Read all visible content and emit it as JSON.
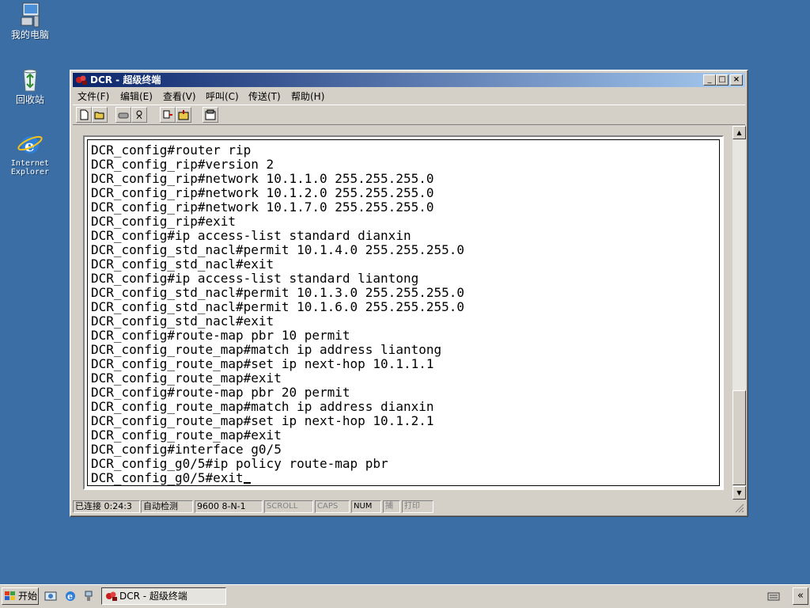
{
  "desktop": {
    "icons": [
      {
        "label": "我的电脑",
        "icon": "my-computer-icon"
      },
      {
        "label": "回收站",
        "icon": "recycle-bin-icon"
      },
      {
        "label": "Internet Explorer",
        "line1": "Internet",
        "line2": "Explorer",
        "icon": "internet-explorer-icon"
      }
    ],
    "background_color": "#3a6ea5"
  },
  "window": {
    "title": "DCR - 超级终端",
    "title_gradient": [
      "#0a246a",
      "#a6caf0"
    ],
    "controls": {
      "minimize": "_",
      "maximize": "□",
      "close": "×"
    },
    "menu": [
      {
        "label": "文件(F)"
      },
      {
        "label": "编辑(E)"
      },
      {
        "label": "查看(V)"
      },
      {
        "label": "呼叫(C)"
      },
      {
        "label": "传送(T)"
      },
      {
        "label": "帮助(H)"
      }
    ],
    "toolbar": [
      "new-icon",
      "open-icon",
      "connect-icon",
      "disconnect-icon",
      "send-icon",
      "receive-icon",
      "properties-icon"
    ]
  },
  "terminal": {
    "lines": [
      "DCR_config#router rip",
      "DCR_config_rip#version 2",
      "DCR_config_rip#network 10.1.1.0 255.255.255.0",
      "DCR_config_rip#network 10.1.2.0 255.255.255.0",
      "DCR_config_rip#network 10.1.7.0 255.255.255.0",
      "DCR_config_rip#exit",
      "DCR_config#ip access-list standard dianxin",
      "DCR_config_std_nacl#permit 10.1.4.0 255.255.255.0",
      "DCR_config_std_nacl#exit",
      "DCR_config#ip access-list standard liantong",
      "DCR_config_std_nacl#permit 10.1.3.0 255.255.255.0",
      "DCR_config_std_nacl#permit 10.1.6.0 255.255.255.0",
      "DCR_config_std_nacl#exit",
      "DCR_config#route-map pbr 10 permit",
      "DCR_config_route_map#match ip address liantong",
      "DCR_config_route_map#set ip next-hop 10.1.1.1",
      "DCR_config_route_map#exit",
      "DCR_config#route-map pbr 20 permit",
      "DCR_config_route_map#match ip address dianxin",
      "DCR_config_route_map#set ip next-hop 10.1.2.1",
      "DCR_config_route_map#exit",
      "DCR_config#interface g0/5",
      "DCR_config_g0/5#ip policy route-map pbr",
      "DCR_config_g0/5#exit"
    ]
  },
  "statusbar": {
    "connected": "已连接 0:24:3",
    "detect": "自动检测",
    "port": "9600 8-N-1",
    "scroll": "SCROLL",
    "caps": "CAPS",
    "num": "NUM",
    "capture": "捕",
    "print": "打印"
  },
  "taskbar": {
    "start_label": "开始",
    "task_label": "DCR - 超级终端",
    "quick_launch": [
      "show-desktop-icon",
      "internet-explorer-icon",
      "network-icon"
    ],
    "tray": [
      "keyboard-icon"
    ],
    "tray_toggle": "«"
  }
}
